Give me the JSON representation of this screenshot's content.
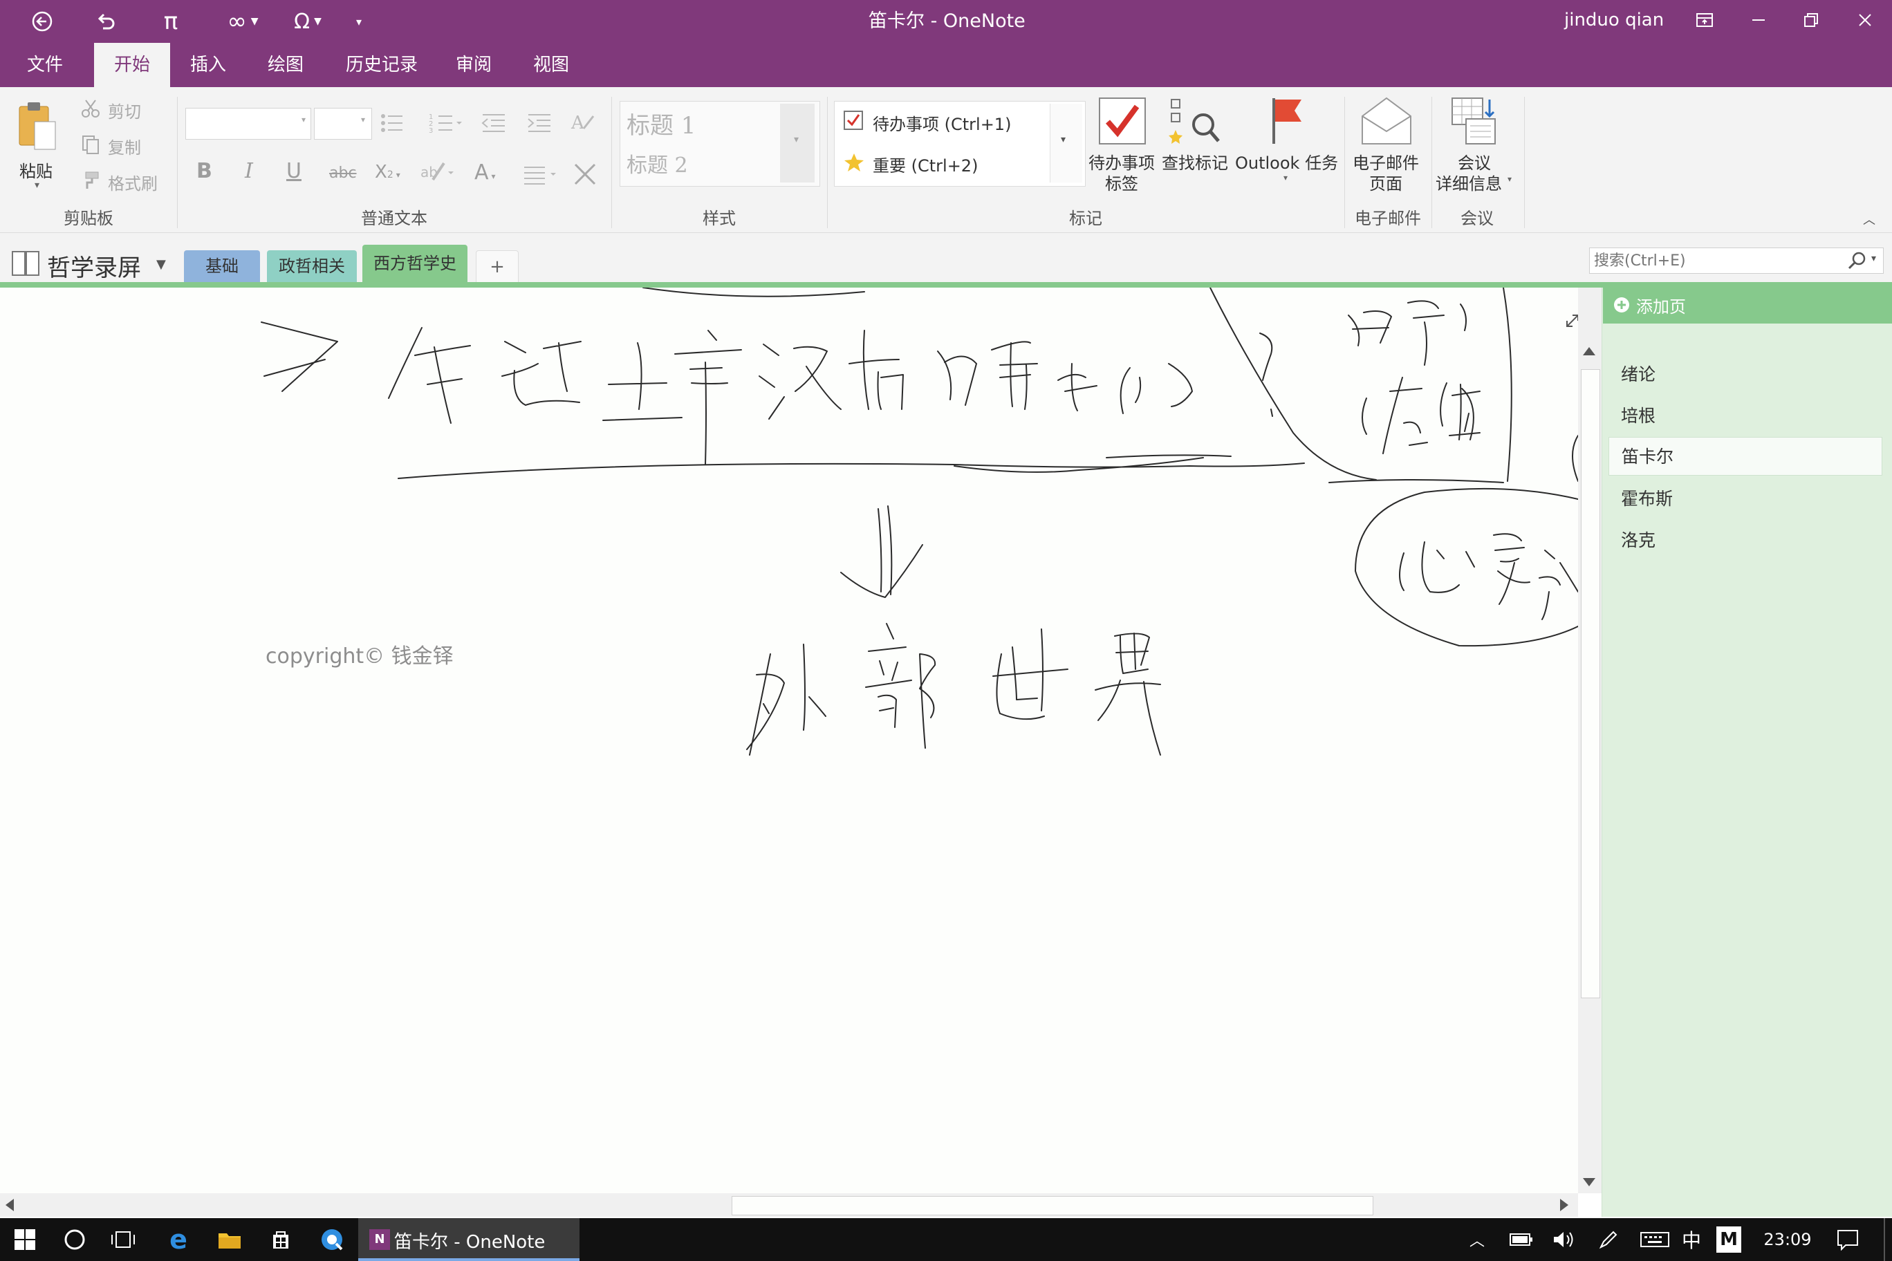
{
  "window": {
    "title": "笛卡尔 - OneNote",
    "user": "jinduo qian"
  },
  "quick_access": [
    {
      "name": "back-icon"
    },
    {
      "name": "undo-icon"
    },
    {
      "name": "pi-icon"
    },
    {
      "name": "infinity-icon"
    },
    {
      "name": "omega-icon"
    },
    {
      "name": "customize-icon"
    }
  ],
  "menu": {
    "tabs": [
      "文件",
      "开始",
      "插入",
      "绘图",
      "历史记录",
      "审阅",
      "视图"
    ],
    "active": "开始"
  },
  "ribbon": {
    "clipboard": {
      "paste": "粘贴",
      "cut": "剪切",
      "copy": "复制",
      "format_painter": "格式刷",
      "label": "剪贴板"
    },
    "basic_text": {
      "label": "普通文本"
    },
    "styles": {
      "heading1": "标题 1",
      "heading2": "标题 2",
      "label": "样式"
    },
    "tags": {
      "todo": "待办事项 (Ctrl+1)",
      "important": "重要 (Ctrl+2)",
      "todo_tag_line1": "待办事项",
      "todo_tag_line2": "标签",
      "find_tags": "查找标记",
      "outlook_tasks": "Outlook 任务",
      "label": "标记"
    },
    "email": {
      "line1": "电子邮件",
      "line2": "页面",
      "label": "电子邮件"
    },
    "meetings": {
      "line1": "会议",
      "line2": "详细信息",
      "label": "会议"
    }
  },
  "notebook": {
    "name": "哲学录屏",
    "sections": [
      {
        "label": "基础",
        "color": "#8fb3dc"
      },
      {
        "label": "政哲相关",
        "color": "#8fd0c4"
      },
      {
        "label": "西方哲学史",
        "color": "#86c98c"
      }
    ],
    "active_section": "西方哲学史",
    "add_section": "+",
    "search_placeholder": "搜索(Ctrl+E)"
  },
  "pages": {
    "add_page": "添加页",
    "items": [
      "绪论",
      "培根",
      "笛卡尔",
      "霍布斯",
      "洛克"
    ],
    "active": "笛卡尔"
  },
  "canvas": {
    "copyright": "copyright© 钱金铎"
  },
  "taskbar": {
    "active_app": "笛卡尔 - OneNote",
    "ime": "中",
    "ime_mode": "M",
    "time": "23:09"
  },
  "colors": {
    "brand": "#80397b",
    "section_green": "#86c98c",
    "page_pane": "#dff0de"
  }
}
